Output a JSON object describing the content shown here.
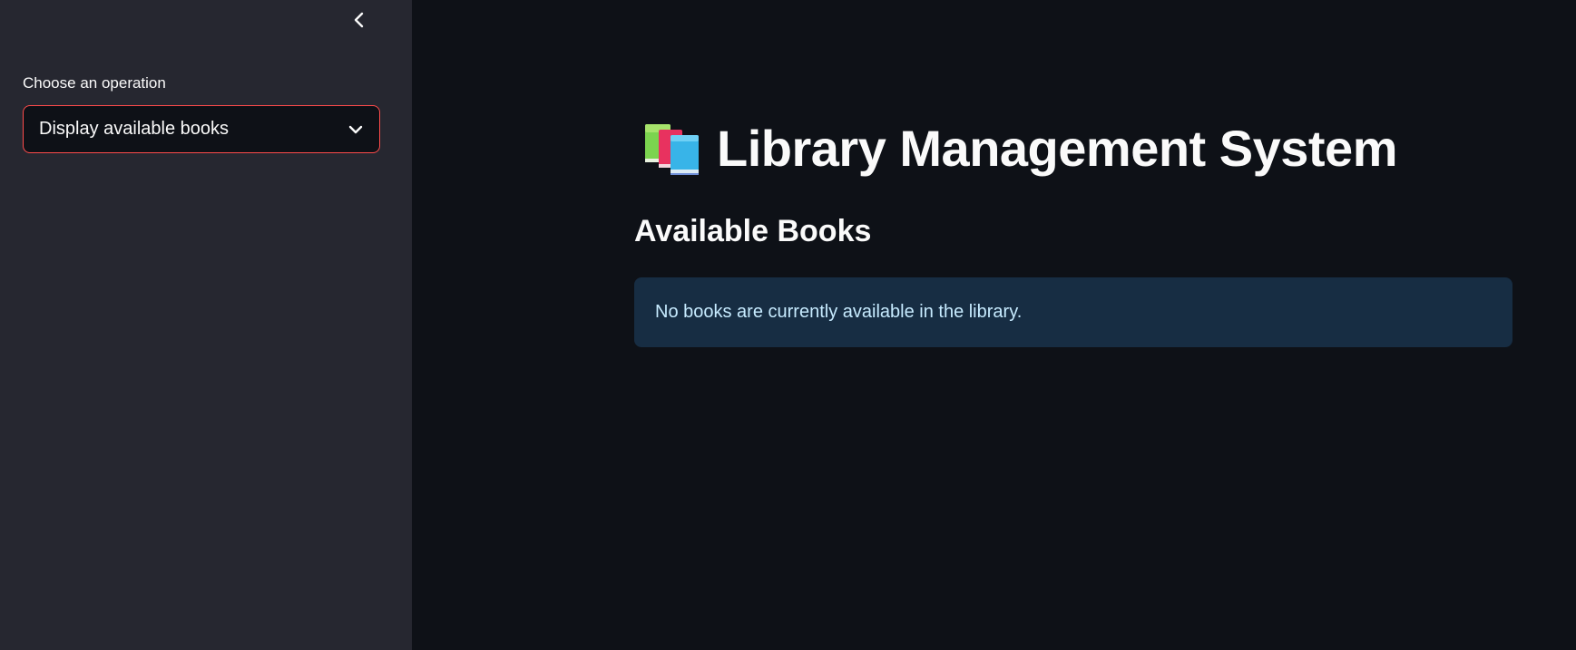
{
  "sidebar": {
    "collapse_icon": "chevron-left-icon",
    "select_label": "Choose an operation",
    "select_value": "Display available books",
    "select_icon": "chevron-down-icon"
  },
  "main": {
    "title_icon": "books-icon",
    "title": "Library Management System",
    "section_heading": "Available Books",
    "info_message": "No books are currently available in the library."
  },
  "colors": {
    "app_background": "#0e1117",
    "sidebar_background": "#262730",
    "select_border": "#ff4b4b",
    "info_background": "#172d43",
    "info_text": "#c7ebff",
    "text": "#fafafa"
  }
}
